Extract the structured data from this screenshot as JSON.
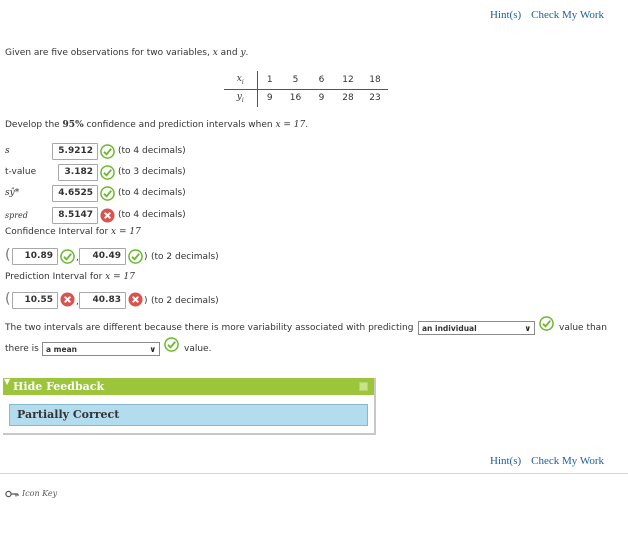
{
  "links": {
    "hints": "Hint(s)",
    "check": "Check My Work"
  },
  "question": {
    "intro_prefix": "Given are five observations for two variables, ",
    "var_x": "x",
    "intro_and": " and ",
    "var_y": "y",
    "intro_end": ".",
    "table": {
      "x_label": "x",
      "x_sub": "i",
      "y_label": "y",
      "y_sub": "i",
      "x_values": [
        "1",
        "5",
        "6",
        "12",
        "18"
      ],
      "y_values": [
        "9",
        "16",
        "9",
        "28",
        "23"
      ]
    },
    "develop_prefix": "Develop the ",
    "develop_pct": "95%",
    "develop_mid": " confidence and prediction intervals when ",
    "develop_x": "x = 17",
    "develop_end": "."
  },
  "answers": [
    {
      "label": "s",
      "value": "5.9212",
      "status": "correct",
      "note": "(to 4 decimals)"
    },
    {
      "label": "t-value",
      "value": "3.182",
      "status": "correct",
      "note": "(to 3 decimals)"
    },
    {
      "label": "sŷ*",
      "value": "4.6525",
      "status": "correct",
      "note": "(to 4 decimals)"
    },
    {
      "label": "spred",
      "value": "8.5147",
      "status": "incorrect",
      "note": "(to 4 decimals)"
    }
  ],
  "confidence": {
    "label": "Confidence Interval for ",
    "label_x": "x = 17",
    "low": "10.89",
    "high": "40.49",
    "note": "(to 2 decimals)"
  },
  "prediction": {
    "label": "Prediction Interval for ",
    "label_x": "x = 17",
    "low": "10.55",
    "high": "40.83",
    "note": "(to 2 decimals)"
  },
  "sentence": {
    "part1": "The two intervals are different because there is more variability associated with predicting",
    "select1": "an individual",
    "part2": "value than",
    "part3": "there is",
    "select2": "a mean",
    "part4": "value."
  },
  "feedback": {
    "toggle": "Hide Feedback",
    "result": "Partially Correct"
  },
  "footer": {
    "icon_key": "Icon Key"
  },
  "colors": {
    "correct": "#6cb82e",
    "incorrect": "#d9534f",
    "link": "#1b5ea1",
    "feedback_head": "#9dc53c",
    "feedback_body": "#b3ddee"
  }
}
